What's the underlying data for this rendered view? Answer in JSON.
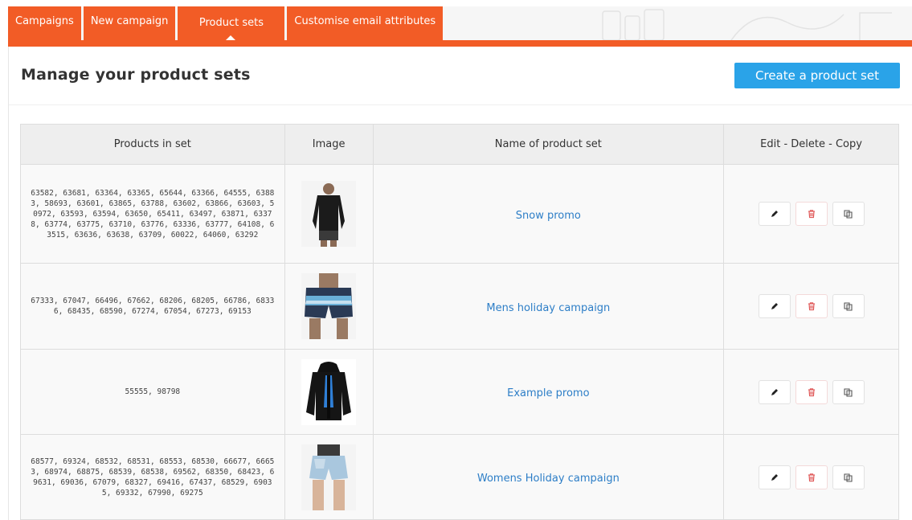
{
  "tabs": [
    {
      "label": "Campaigns"
    },
    {
      "label": "New campaign"
    },
    {
      "label": "Product sets"
    },
    {
      "label": "Customise email attributes"
    }
  ],
  "header": {
    "title": "Manage your product sets",
    "create_button": "Create a product set"
  },
  "table": {
    "columns": [
      "Products in set",
      "Image",
      "Name of product set",
      "Edit - Delete - Copy"
    ],
    "rows": [
      {
        "products": "63582, 63681, 63364, 63365, 65644, 63366, 64555, 63883, 58693, 63601, 63865, 63788, 63602, 63866, 63603, 50972, 63593, 63594, 63650, 65411, 63497, 63871, 63378, 63774, 63775, 63710, 63776, 63336, 63777, 64108, 63515, 63636, 63638, 63709, 60022, 64060, 63292",
        "image": "black-long-sleeve-top",
        "name": "Snow promo"
      },
      {
        "products": "67333, 67047, 66496, 67662, 68206, 68205, 66786, 68336, 68435, 68590, 67274, 67054, 67273, 69153",
        "image": "board-shorts",
        "name": "Mens holiday campaign"
      },
      {
        "products": "55555, 98798",
        "image": "black-jacket",
        "name": "Example promo"
      },
      {
        "products": "68577, 69324, 68532, 68531, 68553, 68530, 66677, 66653, 68974, 68875, 68539, 68538, 69562, 68350, 68423, 69631, 69036, 67079, 68327, 69416, 67437, 68529, 69035, 69332, 67990, 69275",
        "image": "denim-shorts",
        "name": "Womens Holiday campaign"
      }
    ]
  },
  "colors": {
    "accent_orange": "#f25c26",
    "button_blue": "#2aa3e8",
    "link_blue": "#2d7ec7",
    "delete_red": "#e05a5a"
  },
  "icons": [
    "pencil-icon",
    "trash-icon",
    "copy-icon"
  ]
}
